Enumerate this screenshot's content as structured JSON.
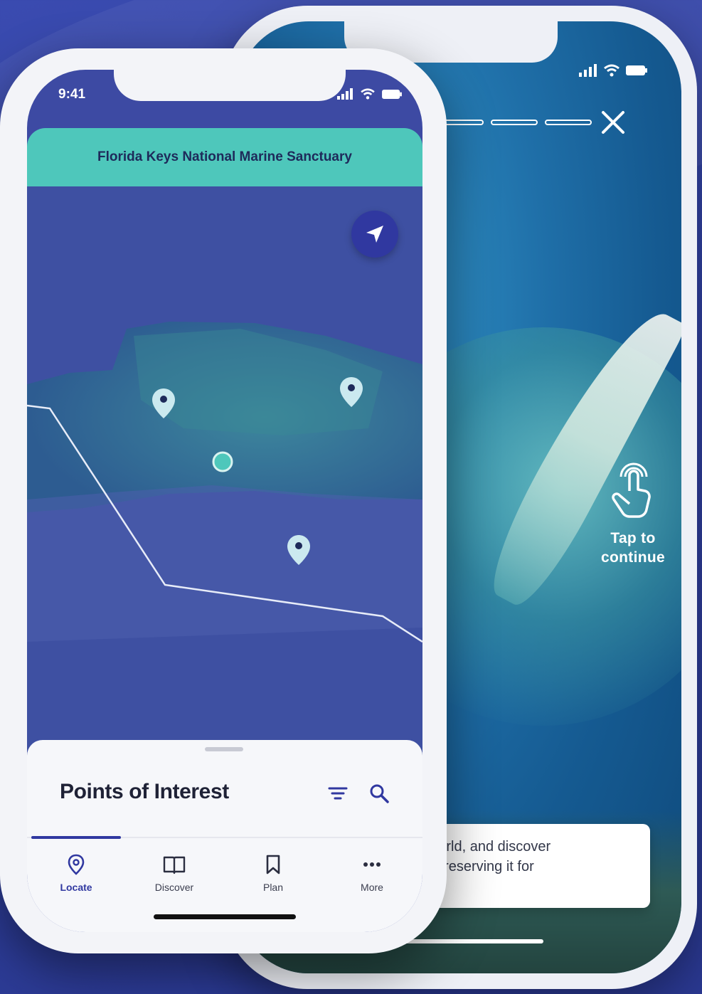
{
  "front_phone": {
    "status_time": "9:41",
    "banner_title": "Florida Keys National Marine Sanctuary",
    "sheet": {
      "title": "Points of Interest"
    },
    "tabs": [
      {
        "label": "Locate",
        "icon": "location-pin-icon",
        "active": true
      },
      {
        "label": "Discover",
        "icon": "book-icon",
        "active": false
      },
      {
        "label": "Plan",
        "icon": "bookmark-icon",
        "active": false
      },
      {
        "label": "More",
        "icon": "more-dots-icon",
        "active": false
      }
    ],
    "colors": {
      "accent": "#3038a0",
      "banner": "#4ec7bb",
      "map": "#3e50a2"
    }
  },
  "back_phone": {
    "tap_hint": "Tap to continue",
    "caption_line_1": "ed world, and discover",
    "caption_line_2": "e of preserving it for"
  }
}
